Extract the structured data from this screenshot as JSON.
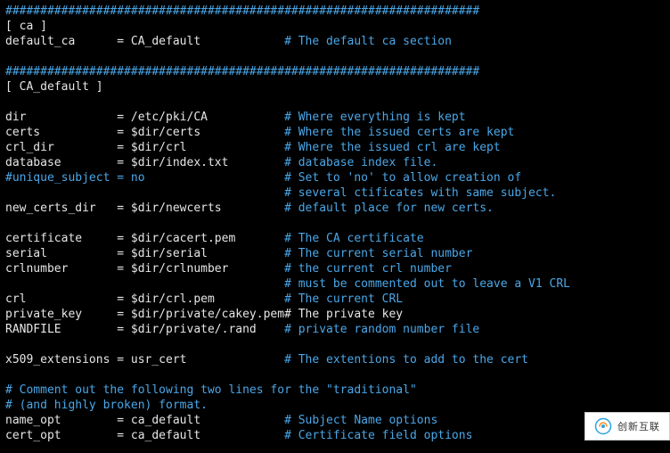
{
  "lines": [
    {
      "t": "cmt",
      "text": "####################################################################"
    },
    {
      "t": "plain",
      "text": "[ ca ]"
    },
    {
      "t": "kvc",
      "key": "default_ca",
      "val": "CA_default",
      "pad1": 6,
      "comment": "# The default ca section"
    },
    {
      "t": "blank"
    },
    {
      "t": "cmt",
      "text": "####################################################################"
    },
    {
      "t": "plain",
      "text": "[ CA_default ]"
    },
    {
      "t": "blank"
    },
    {
      "t": "kvc",
      "key": "dir",
      "val": "/etc/pki/CA",
      "pad1": 13,
      "comment": "# Where everything is kept"
    },
    {
      "t": "kvc",
      "key": "certs",
      "val": "$dir/certs",
      "pad1": 11,
      "comment": "# Where the issued certs are kept"
    },
    {
      "t": "kvc",
      "key": "crl_dir",
      "val": "$dir/crl",
      "pad1": 9,
      "comment": "# Where the issued crl are kept"
    },
    {
      "t": "kvc",
      "key": "database",
      "val": "$dir/index.txt",
      "pad1": 8,
      "comment": "# database index file."
    },
    {
      "t": "cmtkv",
      "text": "#unique_subject = no",
      "comment": "# Set to 'no' to allow creation of"
    },
    {
      "t": "only_c",
      "comment": "# several ctificates with same subject."
    },
    {
      "t": "kvc",
      "key": "new_certs_dir",
      "val": "$dir/newcerts",
      "pad1": 3,
      "comment": "# default place for new certs."
    },
    {
      "t": "blank"
    },
    {
      "t": "kvc",
      "key": "certificate",
      "val": "$dir/cacert.pem",
      "pad1": 5,
      "comment": "# The CA certificate"
    },
    {
      "t": "kvc",
      "key": "serial",
      "val": "$dir/serial",
      "pad1": 10,
      "comment": "# The current serial number"
    },
    {
      "t": "kvc",
      "key": "crlnumber",
      "val": "$dir/crlnumber",
      "pad1": 7,
      "comment": "# the current crl number"
    },
    {
      "t": "only_c",
      "comment": "# must be commented out to leave a V1 CRL"
    },
    {
      "t": "kvc",
      "key": "crl",
      "val": "$dir/crl.pem",
      "pad1": 13,
      "comment": "# The current CRL"
    },
    {
      "t": "kv_inline",
      "key": "private_key",
      "val": "$dir/private/cakey.pem",
      "pad1": 5,
      "inline": "# The private key"
    },
    {
      "t": "kvc",
      "key": "RANDFILE",
      "val": "$dir/private/.rand",
      "pad1": 8,
      "comment": "# private random number file"
    },
    {
      "t": "blank"
    },
    {
      "t": "kvc",
      "key": "x509_extensions",
      "val": "usr_cert",
      "pad1": 1,
      "comment": "# The extentions to add to the cert"
    },
    {
      "t": "blank"
    },
    {
      "t": "cmt",
      "text": "# Comment out the following two lines for the \"traditional\""
    },
    {
      "t": "cmt",
      "text": "# (and highly broken) format."
    },
    {
      "t": "kvc",
      "key": "name_opt",
      "val": "ca_default",
      "pad1": 8,
      "comment": "# Subject Name options"
    },
    {
      "t": "kvc",
      "key": "cert_opt",
      "val": "ca_default",
      "pad1": 8,
      "comment": "# Certificate field options"
    }
  ],
  "watermark": {
    "brand": "创新互联"
  }
}
